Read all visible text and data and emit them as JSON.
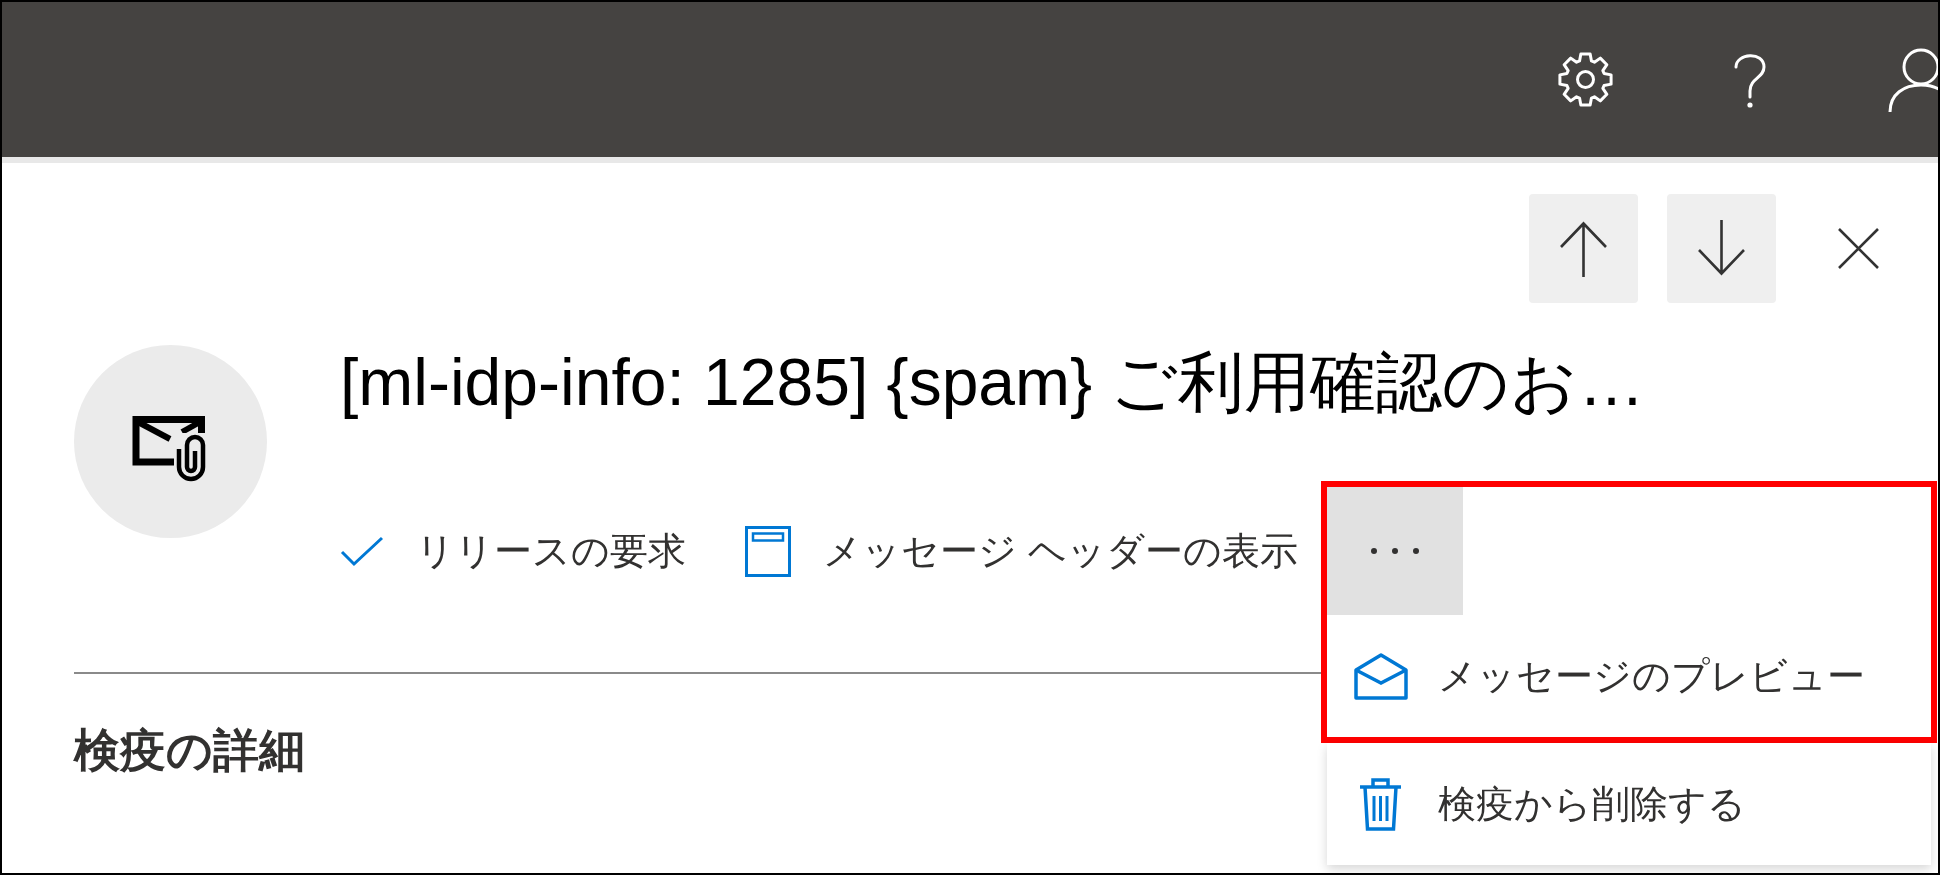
{
  "message": {
    "title": "[ml-idp-info: 1285] {spam} ご利用確認のお…"
  },
  "actions": [
    {
      "kind": "release",
      "label": "リリースの要求"
    },
    {
      "kind": "header",
      "label": "メッセージ ヘッダーの表示"
    }
  ],
  "more_menu": {
    "expanded": true,
    "items": [
      {
        "kind": "preview",
        "label": "メッセージのプレビュー",
        "highlighted": true
      },
      {
        "kind": "delete",
        "label": "検疫から削除する",
        "highlighted": false
      }
    ]
  },
  "section": {
    "heading": "検疫の詳細"
  }
}
